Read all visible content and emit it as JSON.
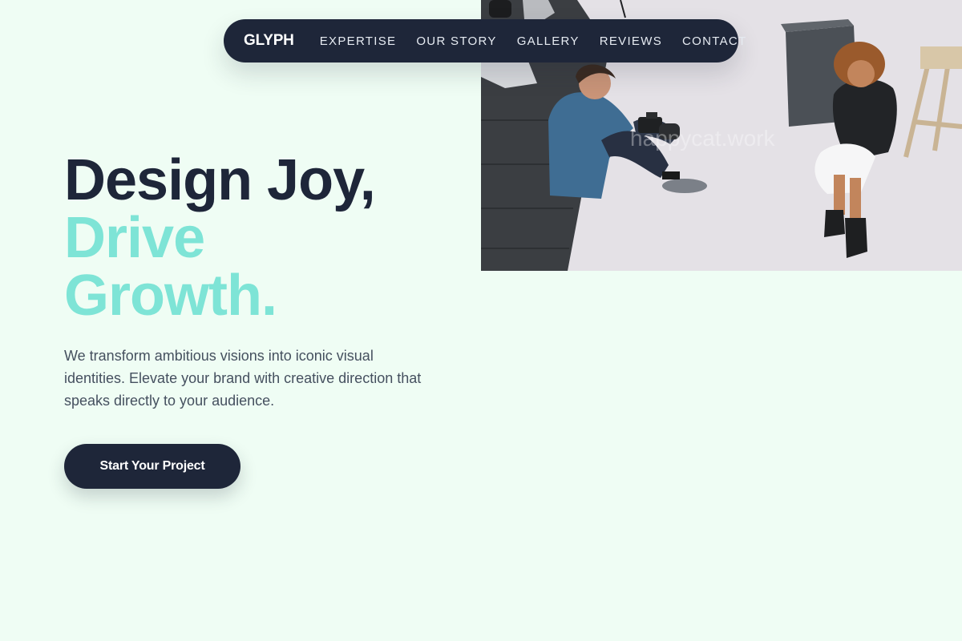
{
  "nav": {
    "logo": "GLYPH",
    "items": [
      {
        "label": "EXPERTISE"
      },
      {
        "label": "OUR STORY"
      },
      {
        "label": "GALLERY"
      },
      {
        "label": "REVIEWS"
      },
      {
        "label": "CONTACT"
      }
    ]
  },
  "hero": {
    "headline_line1": "Design Joy,",
    "headline_line2": "Drive",
    "headline_line3": "Growth.",
    "lead": "We transform ambitious visions into iconic visual identities. Elevate your brand with creative direction that speaks directly to your audience.",
    "cta_label": "Start Your Project",
    "image_watermark": "happycat.work"
  },
  "colors": {
    "page_background": "#effdf4",
    "navy": "#1e2639",
    "accent_mint": "#7ee4d6",
    "body_text": "#45505f"
  }
}
